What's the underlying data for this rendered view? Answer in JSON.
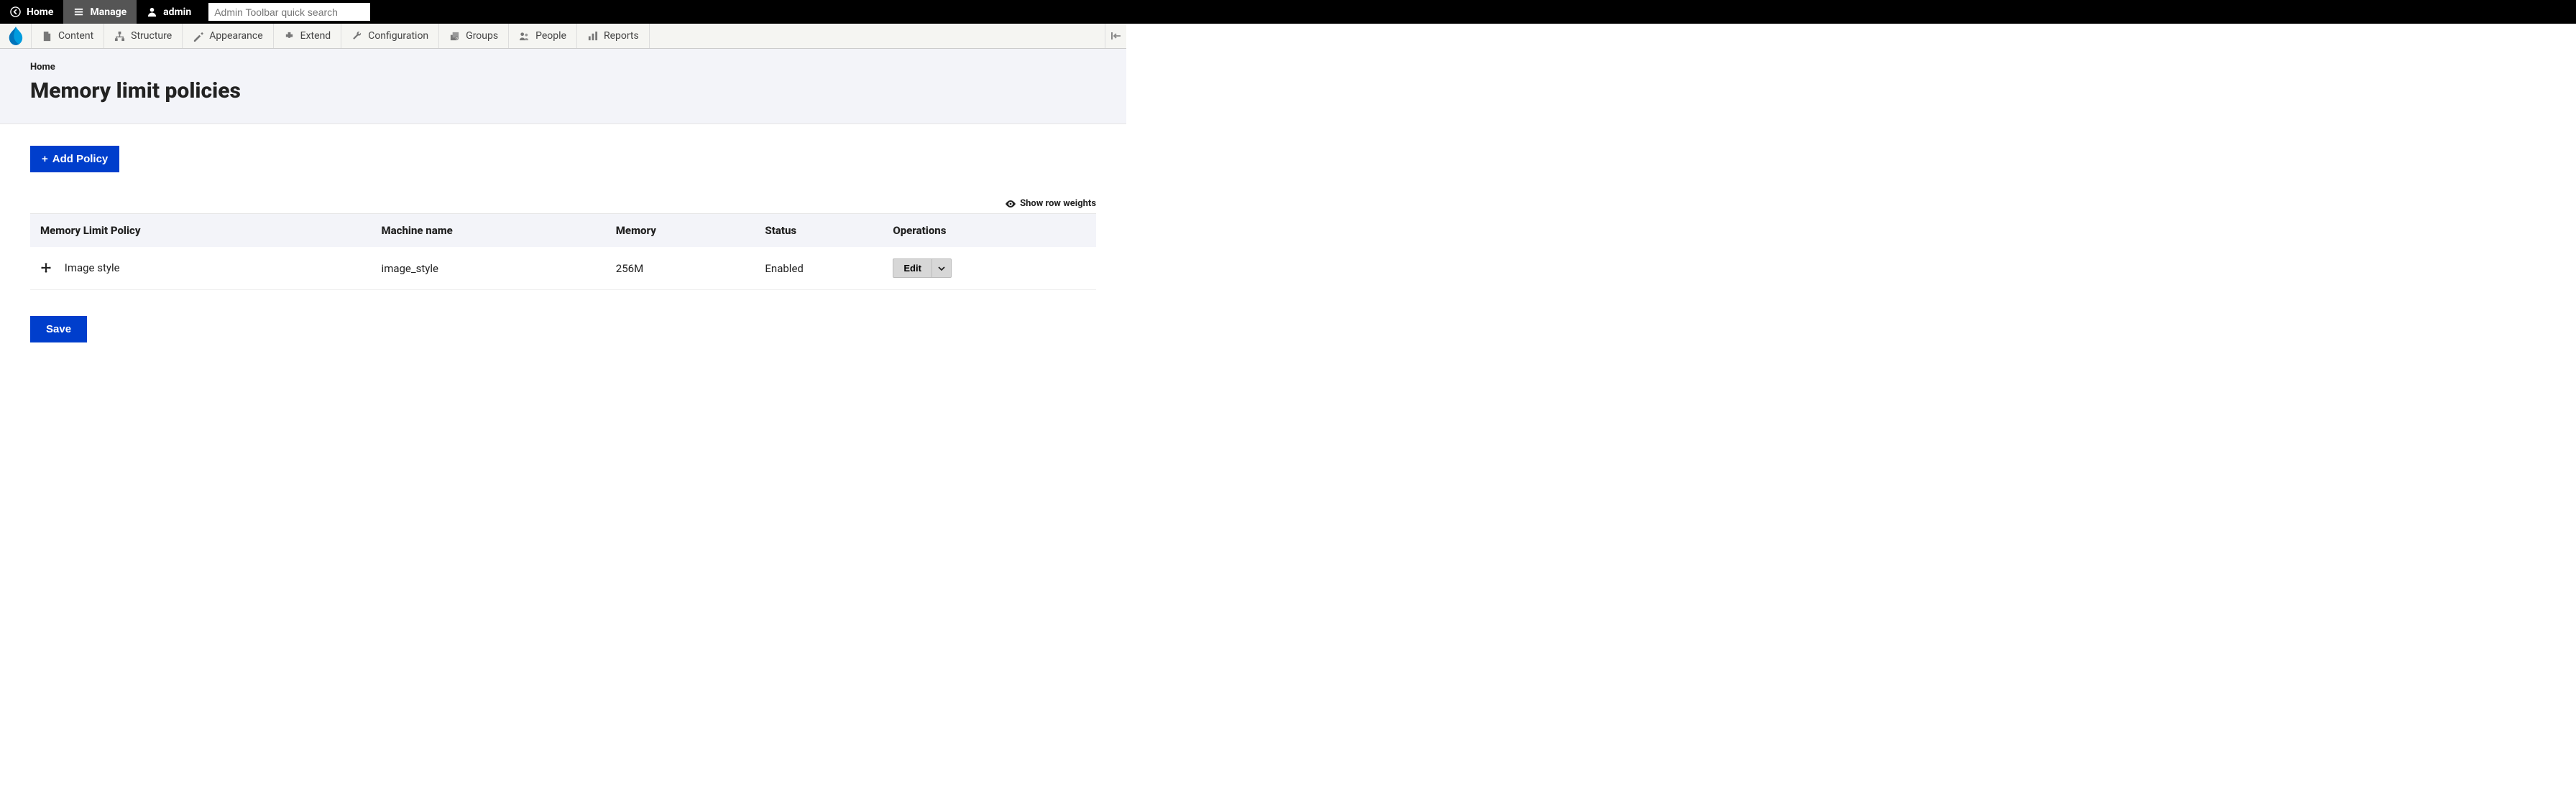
{
  "topbar": {
    "home": "Home",
    "manage": "Manage",
    "admin": "admin",
    "search_placeholder": "Admin Toolbar quick search"
  },
  "admin_menu": {
    "items": [
      {
        "label": "Content"
      },
      {
        "label": "Structure"
      },
      {
        "label": "Appearance"
      },
      {
        "label": "Extend"
      },
      {
        "label": "Configuration"
      },
      {
        "label": "Groups"
      },
      {
        "label": "People"
      },
      {
        "label": "Reports"
      }
    ]
  },
  "breadcrumb": {
    "home": "Home"
  },
  "page": {
    "title": "Memory limit policies"
  },
  "actions": {
    "add_policy": "Add Policy",
    "show_row_weights": "Show row weights",
    "save": "Save"
  },
  "table": {
    "headers": {
      "policy": "Memory Limit Policy",
      "machine": "Machine name",
      "memory": "Memory",
      "status": "Status",
      "operations": "Operations"
    },
    "rows": [
      {
        "policy": "Image style",
        "machine": "image_style",
        "memory": "256M",
        "status": "Enabled",
        "op_edit": "Edit"
      }
    ]
  }
}
